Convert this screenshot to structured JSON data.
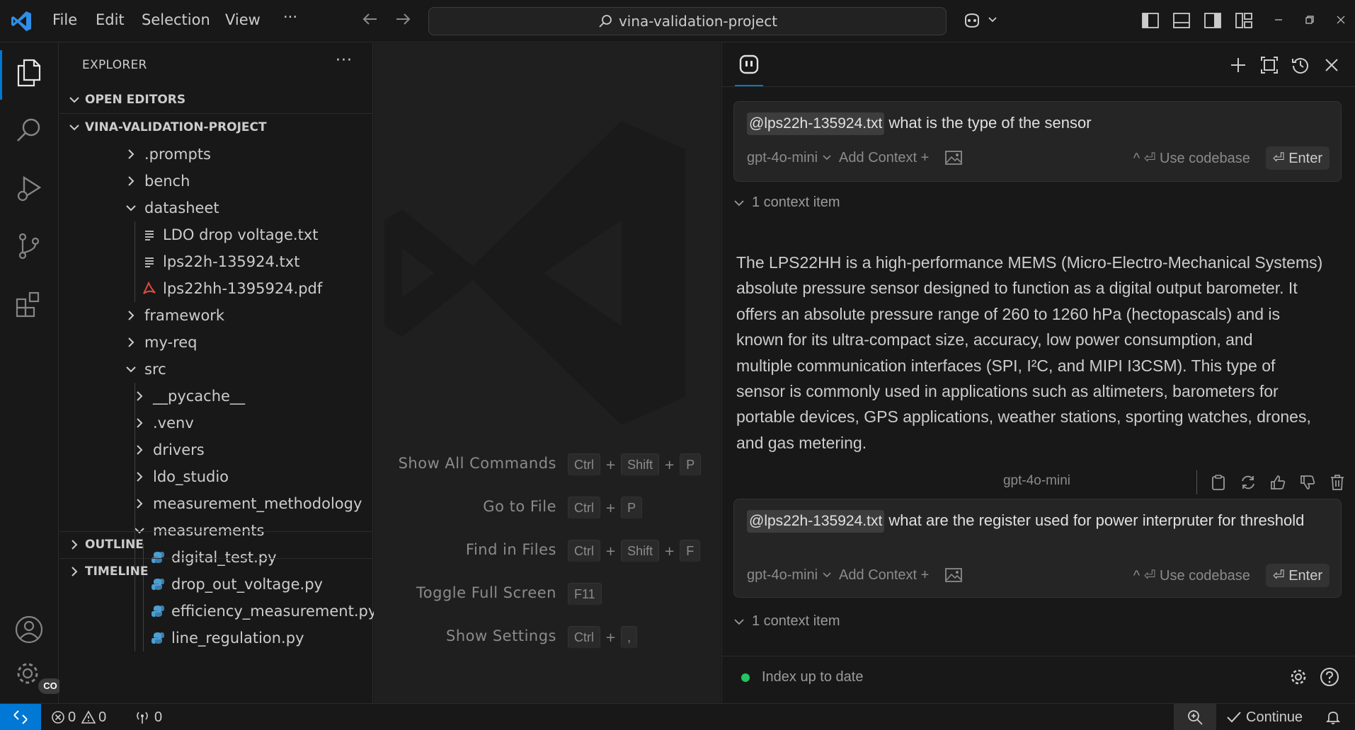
{
  "titlebar": {
    "menu": [
      "File",
      "Edit",
      "Selection",
      "View",
      "···"
    ],
    "search_text": "vina-validation-project"
  },
  "sidebar": {
    "title": "EXPLORER",
    "more": "···",
    "open_editors": "OPEN EDITORS",
    "project": "VINA-VALIDATION-PROJECT",
    "tree": [
      {
        "label": ".prompts",
        "type": "folder",
        "depth": 0,
        "open": false
      },
      {
        "label": "bench",
        "type": "folder",
        "depth": 0,
        "open": false
      },
      {
        "label": "datasheet",
        "type": "folder",
        "depth": 0,
        "open": true
      },
      {
        "label": "LDO drop voltage.txt",
        "type": "txt",
        "depth": 1
      },
      {
        "label": "lps22h-135924.txt",
        "type": "txt",
        "depth": 1
      },
      {
        "label": "lps22hh-1395924.pdf",
        "type": "pdf",
        "depth": 1
      },
      {
        "label": "framework",
        "type": "folder",
        "depth": 0,
        "open": false
      },
      {
        "label": "my-req",
        "type": "folder",
        "depth": 0,
        "open": false
      },
      {
        "label": "src",
        "type": "folder",
        "depth": 0,
        "open": true
      },
      {
        "label": "__pycache__",
        "type": "folder",
        "depth": 1,
        "open": false
      },
      {
        "label": ".venv",
        "type": "folder",
        "depth": 1,
        "open": false
      },
      {
        "label": "drivers",
        "type": "folder",
        "depth": 1,
        "open": false
      },
      {
        "label": "ldo_studio",
        "type": "folder",
        "depth": 1,
        "open": false
      },
      {
        "label": "measurement_methodology",
        "type": "folder",
        "depth": 1,
        "open": false
      },
      {
        "label": "measurements",
        "type": "folder",
        "depth": 1,
        "open": true
      },
      {
        "label": "digital_test.py",
        "type": "py",
        "depth": 2
      },
      {
        "label": "drop_out_voltage.py",
        "type": "py",
        "depth": 2
      },
      {
        "label": "efficiency_measurement.py",
        "type": "py",
        "depth": 2
      },
      {
        "label": "line_regulation.py",
        "type": "py",
        "depth": 2
      }
    ],
    "outline": "OUTLINE",
    "timeline": "TIMELINE"
  },
  "editor": {
    "shortcuts": [
      {
        "label": "Show All Commands",
        "keys": [
          "Ctrl",
          "Shift",
          "P"
        ]
      },
      {
        "label": "Go to File",
        "keys": [
          "Ctrl",
          "P"
        ]
      },
      {
        "label": "Find in Files",
        "keys": [
          "Ctrl",
          "Shift",
          "F"
        ]
      },
      {
        "label": "Toggle Full Screen",
        "keys": [
          "F11"
        ]
      },
      {
        "label": "Show Settings",
        "keys": [
          "Ctrl",
          ","
        ]
      }
    ]
  },
  "chat": {
    "q1": {
      "mention": "@lps22h-135924.txt",
      "text": " what is the type of the sensor",
      "model": "gpt-4o-mini",
      "add_context": "Add Context +",
      "use_codebase": "^ ⏎ Use codebase",
      "enter": "⏎ Enter",
      "context": "1 context item"
    },
    "answer_lines": [
      "The LPS22HH is a high-performance MEMS (Micro-Electro-Mechanical Systems)",
      "absolute pressure sensor designed to function as a digital output barometer. It",
      "offers an absolute pressure range of 260 to 1260 hPa (hectopascals) and is",
      "known for its ultra-compact size, accuracy, low power consumption, and",
      "multiple communication interfaces (SPI, I²C, and MIPI I3CSM). This type of",
      "sensor is commonly used in applications such as altimeters, barometers for",
      "portable devices, GPS applications, weather stations, sporting watches, drones,",
      "and gas metering."
    ],
    "answer_model": "gpt-4o-mini",
    "q2": {
      "mention": "@lps22h-135924.txt",
      "text": " what are the register used for power interpruter for threshold",
      "model": "gpt-4o-mini",
      "add_context": "Add Context +",
      "use_codebase": "^ ⏎ Use codebase",
      "enter": "⏎ Enter",
      "context": "1 context item"
    },
    "index_status": "Index up to date"
  },
  "statusbar": {
    "errors": "0",
    "warnings": "0",
    "ports": "0",
    "continue": "Continue"
  },
  "activitybar": {
    "badge": "CO"
  },
  "colors": {
    "accent": "#0078d4",
    "python_icon": "#4b9fd5",
    "pdf_icon": "#e04b3f",
    "index_ok": "#23c55e"
  }
}
